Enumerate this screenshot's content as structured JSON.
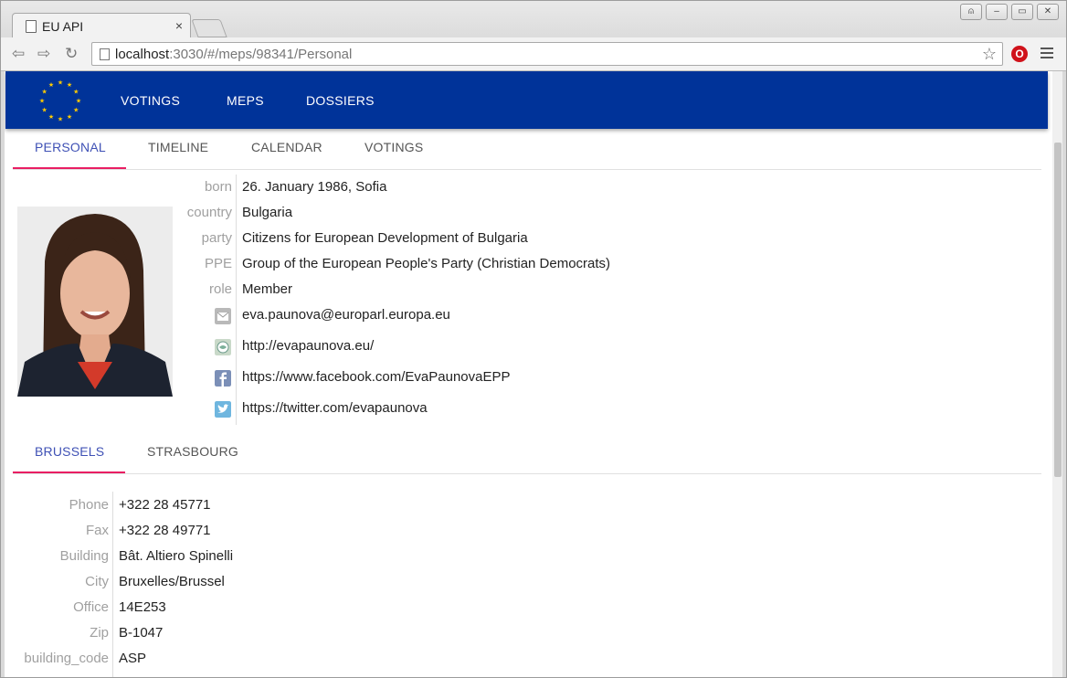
{
  "browser": {
    "tab_title": "EU API",
    "tab_close": "×",
    "url_host": "localhost",
    "url_rest": ":3030/#/meps/98341/Personal",
    "win_user": "⍝",
    "win_min": "–",
    "win_restore": "▭",
    "win_close": "✕",
    "ext_label": "O",
    "star": "☆"
  },
  "appbar": {
    "nav": [
      "VOTINGS",
      "MEPS",
      "DOSSIERS"
    ]
  },
  "subtabs": [
    "PERSONAL",
    "TIMELINE",
    "CALENDAR",
    "VOTINGS"
  ],
  "personal": {
    "born_label": "born",
    "born": "26. January 1986, Sofia",
    "country_label": "country",
    "country": "Bulgaria",
    "party_label": "party",
    "party": "Citizens for European Development of Bulgaria",
    "group_label": "PPE",
    "group": "Group of the European People's Party (Christian Democrats)",
    "role_label": "role",
    "role": "Member",
    "email": "eva.paunova@europarl.europa.eu",
    "website": "http://evapaunova.eu/",
    "facebook": "https://www.facebook.com/EvaPaunovaEPP",
    "twitter": "https://twitter.com/evapaunova"
  },
  "office_tabs": [
    "BRUSSELS",
    "STRASBOURG"
  ],
  "office": {
    "phone_label": "Phone",
    "phone": "+322 28 45771",
    "fax_label": "Fax",
    "fax": "+322 28 49771",
    "building_label": "Building",
    "building": "Bât. Altiero Spinelli",
    "city_label": "City",
    "city": "Bruxelles/Brussel",
    "office_label": "Office",
    "office": "14E253",
    "zip_label": "Zip",
    "zip": "B-1047",
    "building_code_label": "building_code",
    "building_code": "ASP"
  },
  "colors": {
    "appbar": "#003399",
    "active_tab": "#3f51b5",
    "ink": "#e91e63"
  }
}
